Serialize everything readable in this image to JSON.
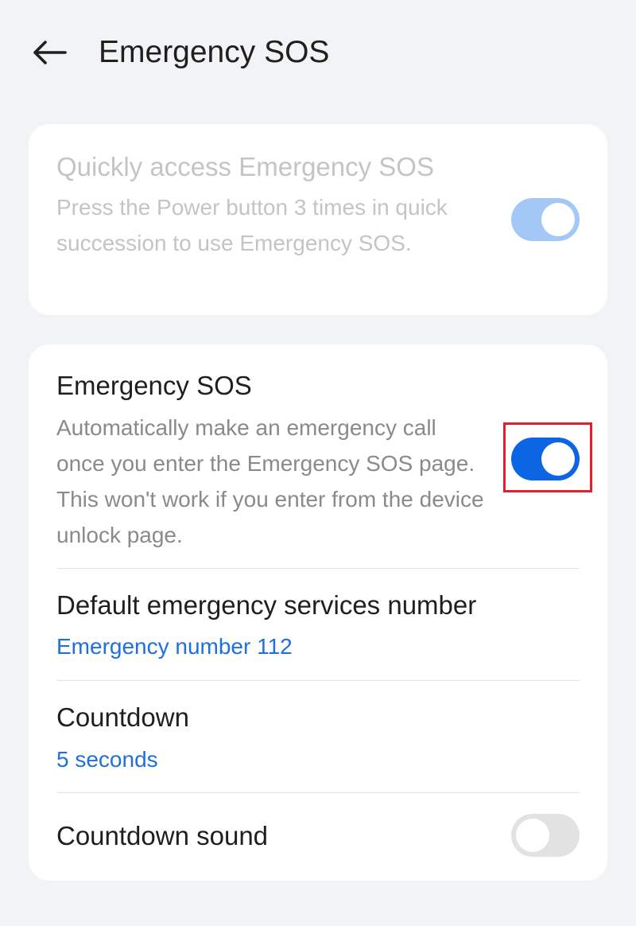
{
  "header": {
    "back_icon": "arrow-left-icon",
    "title": "Emergency SOS"
  },
  "quick_access": {
    "title": "Quickly access Emergency SOS",
    "description": "Press the Power button 3 times in quick succession to use Emergency SOS.",
    "toggle_state": "on",
    "enabled": false
  },
  "settings": {
    "emergency_sos": {
      "title": "Emergency SOS",
      "description": "Automatically make an emergency call once you enter the Emergency SOS page. This won't work if you enter from the device unlock page.",
      "toggle_state": "on",
      "highlight_color": "#e0202a"
    },
    "default_number": {
      "title": "Default emergency services number",
      "value": "Emergency number 112"
    },
    "countdown": {
      "title": "Countdown",
      "value": "5 seconds"
    },
    "countdown_sound": {
      "title": "Countdown sound",
      "toggle_state": "off"
    }
  },
  "colors": {
    "background": "#f2f3f5",
    "accent": "#0c66e4",
    "link": "#1f6fde"
  }
}
